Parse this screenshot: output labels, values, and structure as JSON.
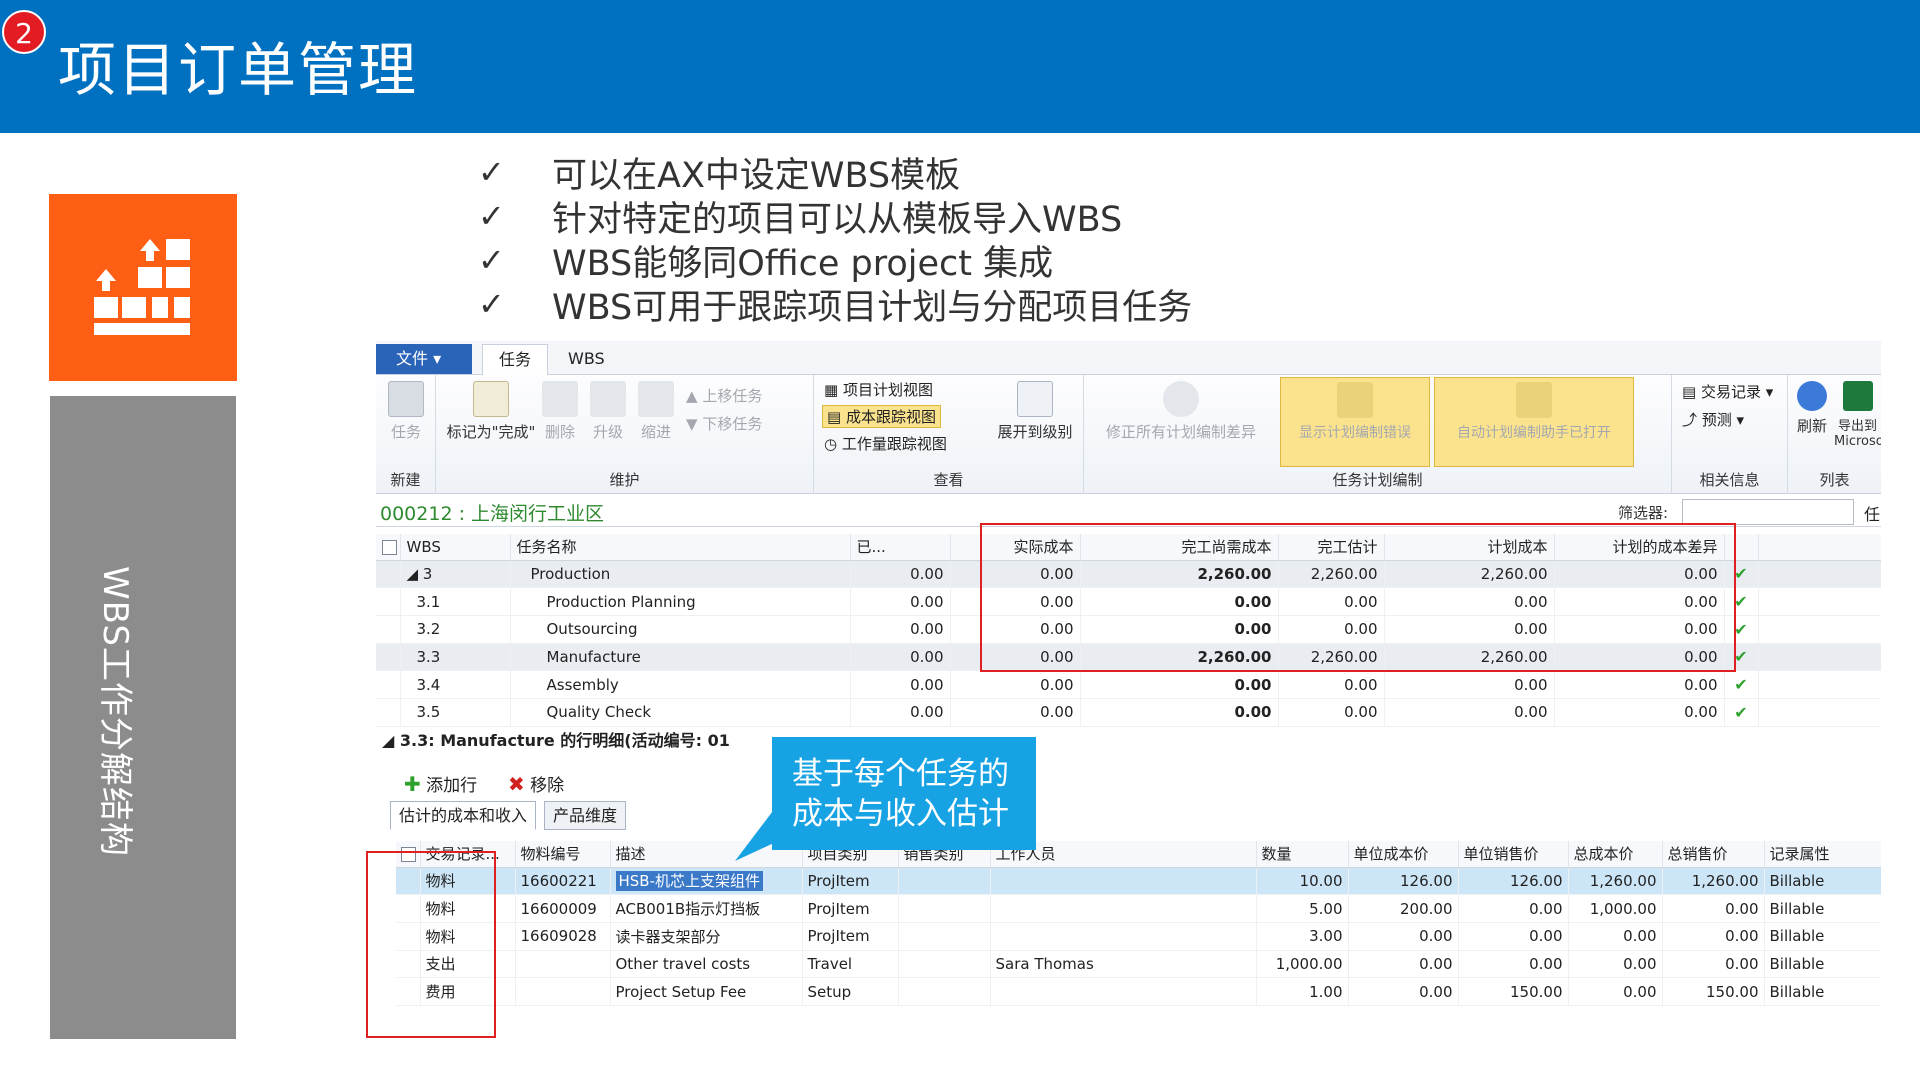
{
  "header": {
    "number": "2",
    "title": "项目订单管理"
  },
  "left_panel": {
    "vertical_title": "WBS工作分解结构",
    "icon": "wbs-hierarchy-icon"
  },
  "bullets": [
    "可以在AX中设定WBS模板",
    "针对特定的项目可以从模板导入WBS",
    "WBS能够同Office project 集成",
    "WBS可用于跟踪项目计划与分配项目任务"
  ],
  "check_mark": "✓",
  "app": {
    "tabs": {
      "file": "文件 ▾",
      "task": "任务",
      "wbs": "WBS"
    },
    "ribbon": {
      "new_group": {
        "label": "新建",
        "task_btn": "任务"
      },
      "maintain_group": {
        "label": "维护",
        "mark_complete": "标记为\"完成\"",
        "delete": "删除",
        "promote": "升级",
        "demote": "缩进",
        "move_up": "上移任务",
        "move_down": "下移任务"
      },
      "view_group": {
        "label": "查看",
        "project_plan_view": "项目计划视图",
        "cost_tracking_view": "成本跟踪视图",
        "effort_tracking_view": "工作量跟踪视图",
        "expand_to_level": "展开到级别"
      },
      "schedule_group": {
        "label": "任务计划编制",
        "fix_all": "修正所有计划编制差异",
        "show_errors": "显示计划编制错误",
        "auto_schedule": "自动计划编制助手已打开"
      },
      "related_group": {
        "label": "相关信息",
        "transactions": "交易记录 ▾",
        "forecast": "预测 ▾"
      },
      "list_group": {
        "label": "列表",
        "refresh": "刷新",
        "export": "导出到 Microsoft"
      }
    },
    "project_name": "000212 : 上海闵行工业区",
    "filter_label": "筛选器:",
    "filter_cut": "任",
    "grid1": {
      "headers": [
        "WBS",
        "任务名称",
        "已...",
        "实际成本",
        "完工尚需成本",
        "完工估计",
        "计划成本",
        "计划的成本差异"
      ],
      "rows": [
        {
          "wbs": "◢ 3",
          "name": "Production",
          "done": "0.00",
          "actual": "0.00",
          "etc": "2,260.00",
          "eac": "2,260.00",
          "planned": "2,260.00",
          "variance": "0.00",
          "check": "✔"
        },
        {
          "wbs": "3.1",
          "name": "Production Planning",
          "done": "0.00",
          "actual": "0.00",
          "etc": "0.00",
          "eac": "0.00",
          "planned": "0.00",
          "variance": "0.00",
          "check": "✔"
        },
        {
          "wbs": "3.2",
          "name": "Outsourcing",
          "done": "0.00",
          "actual": "0.00",
          "etc": "0.00",
          "eac": "0.00",
          "planned": "0.00",
          "variance": "0.00",
          "check": "✔"
        },
        {
          "wbs": "3.3",
          "name": "Manufacture",
          "done": "0.00",
          "actual": "0.00",
          "etc": "2,260.00",
          "eac": "2,260.00",
          "planned": "2,260.00",
          "variance": "0.00",
          "check": "✔"
        },
        {
          "wbs": "3.4",
          "name": "Assembly",
          "done": "0.00",
          "actual": "0.00",
          "etc": "0.00",
          "eac": "0.00",
          "planned": "0.00",
          "variance": "0.00",
          "check": "✔"
        },
        {
          "wbs": "3.5",
          "name": "Quality Check",
          "done": "0.00",
          "actual": "0.00",
          "etc": "0.00",
          "eac": "0.00",
          "planned": "0.00",
          "variance": "0.00",
          "check": "✔"
        }
      ]
    },
    "section_title": "◢  3.3: Manufacture 的行明细(活动编号: 01",
    "actions": {
      "add_line": "添加行",
      "remove": "移除"
    },
    "subtabs": {
      "estimates": "估计的成本和收入",
      "product_dims": "产品维度"
    },
    "grid2": {
      "headers": [
        "交易记录...",
        "物料编号",
        "描述",
        "项目类别",
        "销售类别",
        "工作人员",
        "数量",
        "单位成本价",
        "单位销售价",
        "总成本价",
        "总销售价",
        "记录属性"
      ],
      "rows": [
        {
          "type": "物料",
          "item": "16600221",
          "desc": "HSB-机芯上支架组件",
          "category": "ProjItem",
          "sales_cat": "",
          "worker": "",
          "qty": "10.00",
          "unit_cost": "126.00",
          "unit_sales": "126.00",
          "total_cost": "1,260.00",
          "total_sales": "1,260.00",
          "attr": "Billable"
        },
        {
          "type": "物料",
          "item": "16600009",
          "desc": "ACB001B指示灯挡板",
          "category": "ProjItem",
          "sales_cat": "",
          "worker": "",
          "qty": "5.00",
          "unit_cost": "200.00",
          "unit_sales": "0.00",
          "total_cost": "1,000.00",
          "total_sales": "0.00",
          "attr": "Billable"
        },
        {
          "type": "物料",
          "item": "16609028",
          "desc": "读卡器支架部分",
          "category": "ProjItem",
          "sales_cat": "",
          "worker": "",
          "qty": "3.00",
          "unit_cost": "0.00",
          "unit_sales": "0.00",
          "total_cost": "0.00",
          "total_sales": "0.00",
          "attr": "Billable"
        },
        {
          "type": "支出",
          "item": "",
          "desc": "Other travel costs",
          "category": "Travel",
          "sales_cat": "",
          "worker": "Sara Thomas",
          "qty": "1,000.00",
          "unit_cost": "0.00",
          "unit_sales": "0.00",
          "total_cost": "0.00",
          "total_sales": "0.00",
          "attr": "Billable"
        },
        {
          "type": "费用",
          "item": "",
          "desc": "Project Setup Fee",
          "category": "Setup",
          "sales_cat": "",
          "worker": "",
          "qty": "1.00",
          "unit_cost": "0.00",
          "unit_sales": "150.00",
          "total_cost": "0.00",
          "total_sales": "150.00",
          "attr": "Billable"
        }
      ]
    }
  },
  "callout": {
    "line1": "基于每个任务的",
    "line2": "成本与收入估计"
  },
  "colors": {
    "header_blue": "#0070c0",
    "orange": "#ff5f14",
    "gray": "#8c8c8c",
    "callout": "#17a2e3",
    "highlight_red": "#e02020"
  }
}
